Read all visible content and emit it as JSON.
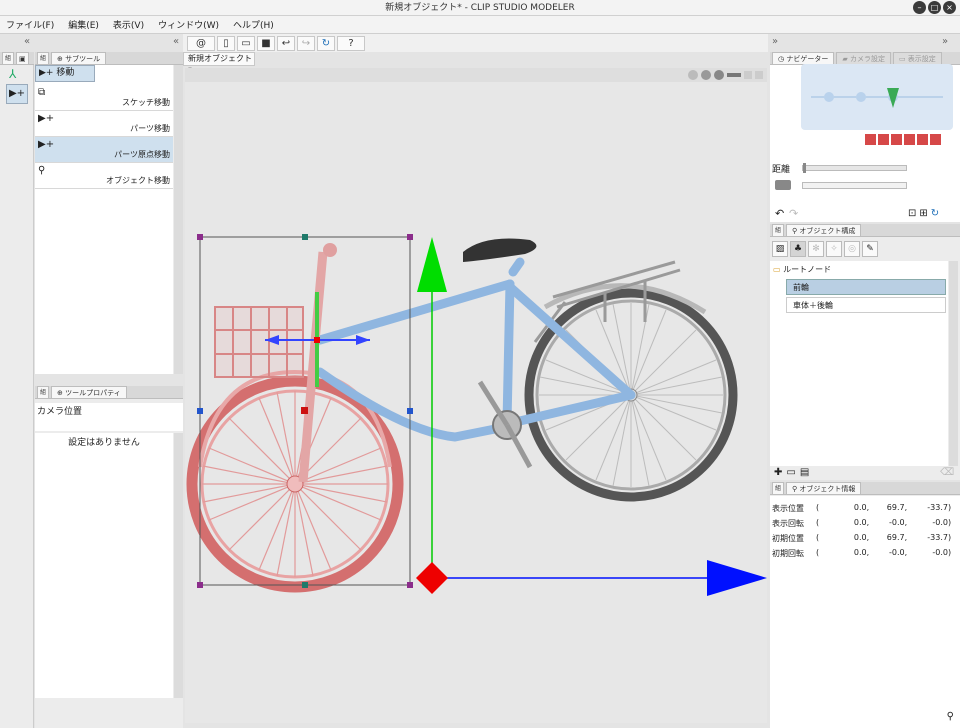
{
  "window": {
    "title": "新規オブジェクト* - CLIP STUDIO MODELER"
  },
  "menu": [
    {
      "label": "ファイル(F)"
    },
    {
      "label": "編集(E)"
    },
    {
      "label": "表示(V)"
    },
    {
      "label": "ウィンドウ(W)"
    },
    {
      "label": "ヘルプ(H)"
    }
  ],
  "toolbar": {
    "icons": [
      "swirl-icon",
      "new-file-icon",
      "open-file-icon",
      "save-icon",
      "undo-icon",
      "redo-icon",
      "refresh-icon",
      "help-icon"
    ]
  },
  "document_tab": {
    "label": "新規オブジェクト*",
    "close": "●"
  },
  "left_tabs": {
    "subtool": "サブツール",
    "tool_property": "ツールプロパティ",
    "group": "組"
  },
  "subtool": {
    "header": "移動",
    "items": [
      {
        "label": "スケッチ移動"
      },
      {
        "label": "パーツ移動"
      },
      {
        "label": "パーツ原点移動"
      },
      {
        "label": "オブジェクト移動"
      }
    ]
  },
  "tool_property": {
    "camera_label": "カメラ位置",
    "empty_text": "設定はありません"
  },
  "navigator": {
    "tabs": [
      "ナビゲーター",
      "カメラ設定",
      "表示設定"
    ],
    "distance_label": "距離",
    "distance_value": 0.0
  },
  "object_structure": {
    "tab": "オブジェクト構成",
    "root": "ルートノード",
    "children": [
      {
        "label": "前輪",
        "selected": true
      },
      {
        "label": "車体＋後輪",
        "selected": false
      }
    ]
  },
  "object_info": {
    "tab": "オブジェクト情報",
    "rows": [
      {
        "label": "表示位置",
        "open": "(",
        "x": "0.0,",
        "y": "69.7,",
        "z": "-33.7)"
      },
      {
        "label": "表示回転",
        "open": "(",
        "x": "0.0,",
        "y": "-0.0,",
        "z": "-0.0)"
      },
      {
        "label": "初期位置",
        "open": "(",
        "x": "0.0,",
        "y": "69.7,",
        "z": "-33.7)"
      },
      {
        "label": "初期回転",
        "open": "(",
        "x": "0.0,",
        "y": "-0.0,",
        "z": "-0.0)"
      }
    ]
  },
  "colors": {
    "accent": "#1f6fb8",
    "selection": "#cfe0ee",
    "front_wheel": "#e07a7a",
    "frame": "#8fb6e0",
    "gizmo_x": "#0010ff",
    "gizmo_y": "#00cc00",
    "gizmo_origin": "#ee0000"
  }
}
